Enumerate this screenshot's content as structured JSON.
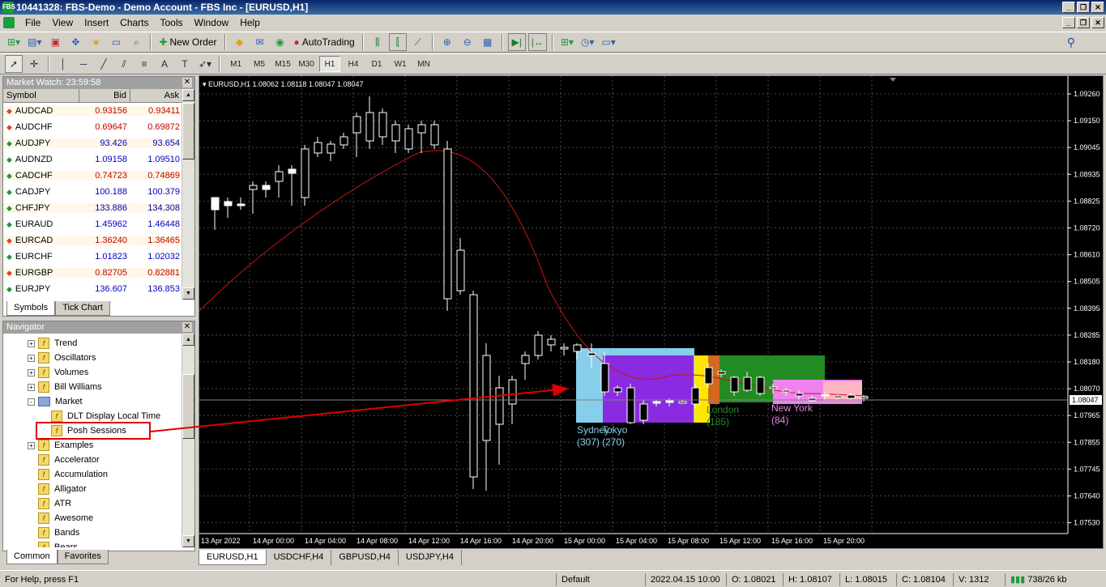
{
  "window": {
    "title": "10441328: FBS-Demo - Demo Account - FBS Inc - [EURUSD,H1]",
    "app_icon": "FBS"
  },
  "menu": [
    "File",
    "View",
    "Insert",
    "Charts",
    "Tools",
    "Window",
    "Help"
  ],
  "toolbar": {
    "new_order": "New Order",
    "autotrading": "AutoTrading"
  },
  "timeframes": [
    "M1",
    "M5",
    "M15",
    "M30",
    "H1",
    "H4",
    "D1",
    "W1",
    "MN"
  ],
  "active_timeframe": "H1",
  "market_watch": {
    "title": "Market Watch: 23:59:58",
    "headers": [
      "Symbol",
      "Bid",
      "Ask"
    ],
    "rows": [
      {
        "symbol": "AUDCAD",
        "bid": "0.93156",
        "ask": "0.93411",
        "dir": "down",
        "color": "#c00000"
      },
      {
        "symbol": "AUDCHF",
        "bid": "0.69647",
        "ask": "0.69872",
        "dir": "down",
        "color": "#c00000"
      },
      {
        "symbol": "AUDJPY",
        "bid": "93.426",
        "ask": "93.654",
        "dir": "up",
        "color": "#0000c0"
      },
      {
        "symbol": "AUDNZD",
        "bid": "1.09158",
        "ask": "1.09510",
        "dir": "up",
        "color": "#0000c0"
      },
      {
        "symbol": "CADCHF",
        "bid": "0.74723",
        "ask": "0.74869",
        "dir": "up",
        "color": "#c00000"
      },
      {
        "symbol": "CADJPY",
        "bid": "100.188",
        "ask": "100.379",
        "dir": "up",
        "color": "#0000c0"
      },
      {
        "symbol": "CHFJPY",
        "bid": "133.886",
        "ask": "134.308",
        "dir": "up",
        "color": "#0000c0"
      },
      {
        "symbol": "EURAUD",
        "bid": "1.45962",
        "ask": "1.46448",
        "dir": "up",
        "color": "#0000c0"
      },
      {
        "symbol": "EURCAD",
        "bid": "1.36240",
        "ask": "1.36465",
        "dir": "down",
        "color": "#c00000"
      },
      {
        "symbol": "EURCHF",
        "bid": "1.01823",
        "ask": "1.02032",
        "dir": "up",
        "color": "#0000c0"
      },
      {
        "symbol": "EURGBP",
        "bid": "0.82705",
        "ask": "0.82881",
        "dir": "down",
        "color": "#c00000"
      },
      {
        "symbol": "EURJPY",
        "bid": "136.607",
        "ask": "136.853",
        "dir": "up",
        "color": "#0000c0"
      }
    ],
    "tabs": [
      "Symbols",
      "Tick Chart"
    ]
  },
  "navigator": {
    "title": "Navigator",
    "items": [
      {
        "label": "Trend",
        "kind": "f",
        "exp": "+",
        "indent": 0
      },
      {
        "label": "Oscillators",
        "kind": "f",
        "exp": "+",
        "indent": 0
      },
      {
        "label": "Volumes",
        "kind": "f",
        "exp": "+",
        "indent": 0
      },
      {
        "label": "Bill Williams",
        "kind": "f",
        "exp": "+",
        "indent": 0
      },
      {
        "label": "Market",
        "kind": "folder",
        "exp": "-",
        "indent": 0
      },
      {
        "label": "DLT Display Local Time",
        "kind": "f",
        "exp": "",
        "indent": 1
      },
      {
        "label": "Posh Sessions",
        "kind": "f",
        "exp": "",
        "indent": 1
      },
      {
        "label": "Examples",
        "kind": "f",
        "exp": "+",
        "indent": 0
      },
      {
        "label": "Accelerator",
        "kind": "f",
        "exp": "",
        "indent": 0
      },
      {
        "label": "Accumulation",
        "kind": "f",
        "exp": "",
        "indent": 0
      },
      {
        "label": "Alligator",
        "kind": "f",
        "exp": "",
        "indent": 0
      },
      {
        "label": "ATR",
        "kind": "f",
        "exp": "",
        "indent": 0
      },
      {
        "label": "Awesome",
        "kind": "f",
        "exp": "",
        "indent": 0
      },
      {
        "label": "Bands",
        "kind": "f",
        "exp": "",
        "indent": 0
      },
      {
        "label": "Bears",
        "kind": "f",
        "exp": "",
        "indent": 0
      }
    ],
    "tabs": [
      "Common",
      "Favorites"
    ]
  },
  "chart": {
    "header": "EURUSD,H1  1.08062 1.08118 1.08047 1.08047",
    "price_labels": [
      "1.09260",
      "1.09150",
      "1.09045",
      "1.08935",
      "1.08825",
      "1.08720",
      "1.08610",
      "1.08505",
      "1.08395",
      "1.08285",
      "1.08180",
      "1.08070",
      "1.07965",
      "1.07855",
      "1.07745",
      "1.07640",
      "1.07530"
    ],
    "current_price": "1.08047",
    "time_labels": [
      "13 Apr 2022",
      "14 Apr 00:00",
      "14 Apr 04:00",
      "14 Apr 08:00",
      "14 Apr 12:00",
      "14 Apr 16:00",
      "14 Apr 20:00",
      "15 Apr 00:00",
      "15 Apr 04:00",
      "15 Apr 08:00",
      "15 Apr 12:00",
      "15 Apr 16:00",
      "15 Apr 20:00"
    ],
    "sessions": [
      {
        "name": "Sydney",
        "count": "(307)",
        "color": "#87ceeb"
      },
      {
        "name": "Tokyo",
        "count": "(270)",
        "color": "#8a2be2"
      },
      {
        "name": "London",
        "count": "(185)",
        "color": "#228b22"
      },
      {
        "name": "New York",
        "count": "(84)",
        "color": "#ee82ee"
      }
    ],
    "ma_color": "#c81414"
  },
  "chart_tabs": [
    "EURUSD,H1",
    "USDCHF,H4",
    "GBPUSD,H4",
    "USDJPY,H4"
  ],
  "status": {
    "help": "For Help, press F1",
    "profile": "Default",
    "datetime": "2022.04.15 10:00",
    "open": "O: 1.08021",
    "high": "H: 1.08107",
    "low": "L: 1.08015",
    "close": "C: 1.08104",
    "volume": "V: 1312",
    "traffic": "738/26 kb"
  }
}
